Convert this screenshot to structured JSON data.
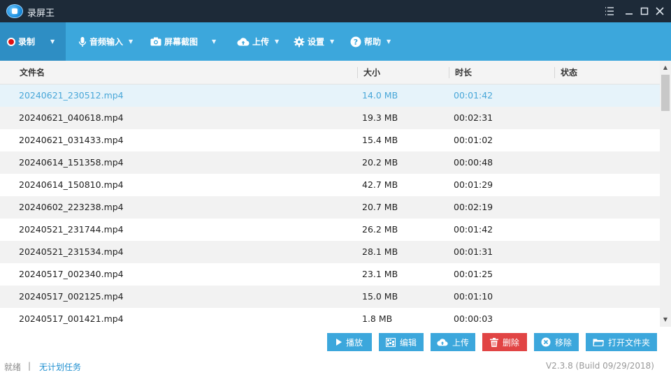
{
  "window": {
    "title": "录屏王"
  },
  "toolbar": {
    "record": "录制",
    "audio_input": "音频输入",
    "screenshot": "屏幕截图",
    "upload": "上传",
    "settings": "设置",
    "help": "帮助"
  },
  "table": {
    "columns": [
      "文件名",
      "大小",
      "时长",
      "状态"
    ],
    "rows": [
      {
        "name": "20240621_230512.mp4",
        "size": "14.0 MB",
        "duration": "00:01:42",
        "status": ""
      },
      {
        "name": "20240621_040618.mp4",
        "size": "19.3 MB",
        "duration": "00:02:31",
        "status": ""
      },
      {
        "name": "20240621_031433.mp4",
        "size": "15.4 MB",
        "duration": "00:01:02",
        "status": ""
      },
      {
        "name": "20240614_151358.mp4",
        "size": "20.2 MB",
        "duration": "00:00:48",
        "status": ""
      },
      {
        "name": "20240614_150810.mp4",
        "size": "42.7 MB",
        "duration": "00:01:29",
        "status": ""
      },
      {
        "name": "20240602_223238.mp4",
        "size": "20.7 MB",
        "duration": "00:02:19",
        "status": ""
      },
      {
        "name": "20240521_231744.mp4",
        "size": "26.2 MB",
        "duration": "00:01:42",
        "status": ""
      },
      {
        "name": "20240521_231534.mp4",
        "size": "28.1 MB",
        "duration": "00:01:31",
        "status": ""
      },
      {
        "name": "20240517_002340.mp4",
        "size": "23.1 MB",
        "duration": "00:01:25",
        "status": ""
      },
      {
        "name": "20240517_002125.mp4",
        "size": "15.0 MB",
        "duration": "00:01:10",
        "status": ""
      },
      {
        "name": "20240517_001421.mp4",
        "size": "1.8 MB",
        "duration": "00:00:03",
        "status": ""
      }
    ],
    "selected_index": 0
  },
  "actions": {
    "play": "播放",
    "edit": "编辑",
    "upload": "上传",
    "delete": "删除",
    "remove": "移除",
    "open_folder": "打开文件夹"
  },
  "status": {
    "state": "就绪",
    "separator": "|",
    "schedule": "无计划任务",
    "version": "V2.3.8 (Build 09/29/2018)"
  },
  "colors": {
    "titlebar": "#1d2a38",
    "toolbar": "#3ca7dc",
    "toolbar_active": "#2e8ec4",
    "selected_row_text": "#49a7d8",
    "delete_button": "#e14444",
    "link": "#1f8fd0"
  }
}
